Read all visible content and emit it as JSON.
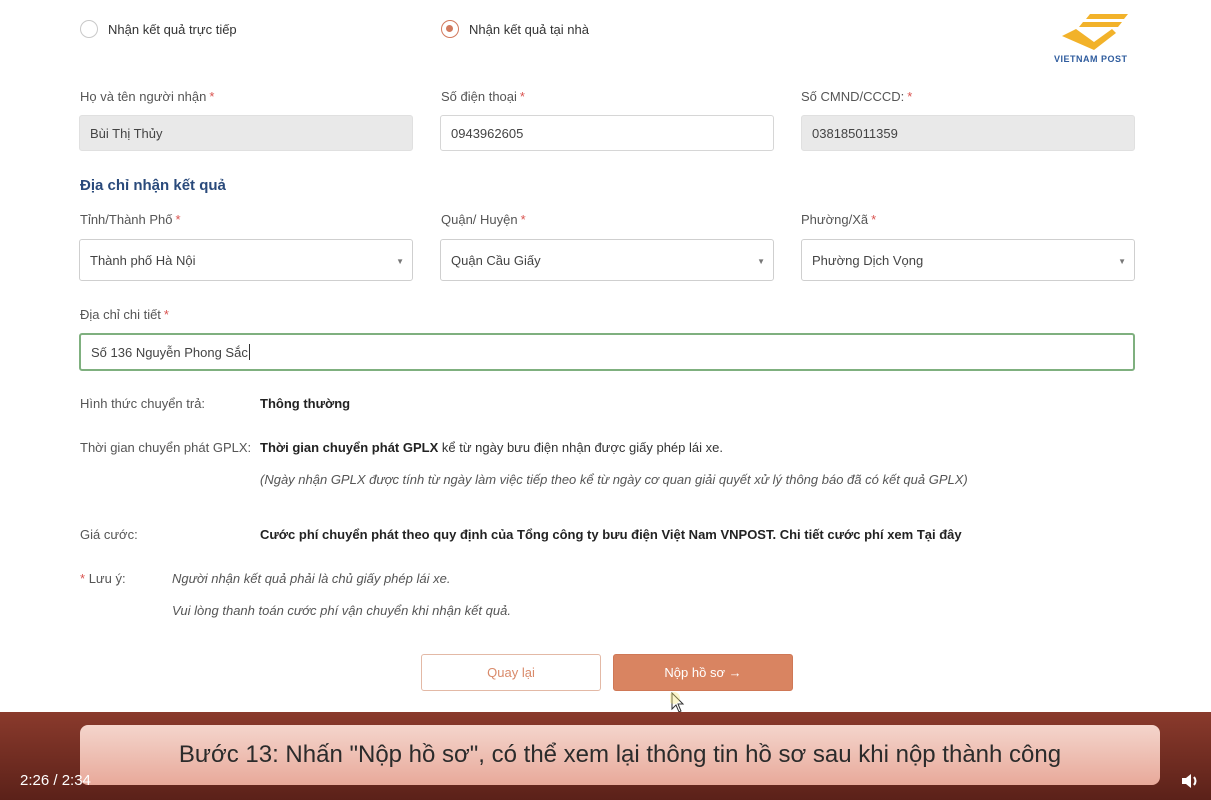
{
  "delivery_options": {
    "direct_label": "Nhận kết quả trực tiếp",
    "home_label": "Nhận kết quả tại nhà",
    "selected": "home"
  },
  "logo": {
    "text": "VIETNAM POST",
    "colors": {
      "yellow": "#f2b22a",
      "blue": "#2f5c9e"
    }
  },
  "recipient": {
    "name_label": "Họ và tên người nhận",
    "name_value": "Bùi Thị Thủy",
    "phone_label": "Số điện thoại",
    "phone_value": "0943962605",
    "id_label": "Số CMND/CCCD:",
    "id_value": "038185011359",
    "required_mark": "*"
  },
  "address": {
    "section_title": "Địa chỉ nhận kết quả",
    "province_label": "Tỉnh/Thành Phố",
    "province_value": "Thành phố Hà Nội",
    "district_label": "Quận/ Huyện",
    "district_value": "Quận Cầu Giấy",
    "ward_label": "Phường/Xã",
    "ward_value": "Phường Dịch Vọng",
    "detail_label": "Địa chỉ chi tiết",
    "detail_value": "Số 136 Nguyễn Phong Sắc"
  },
  "info": {
    "method_label": "Hình thức chuyển trả:",
    "method_value": "Thông thường",
    "time_label": "Thời gian chuyển phát GPLX:",
    "time_value_bold": "Thời gian chuyển phát GPLX",
    "time_value_rest": " kể từ ngày bưu điện nhận được giấy phép lái xe.",
    "time_note": "(Ngày nhận GPLX được tính từ ngày làm việc tiếp theo kể từ ngày cơ quan giải quyết xử lý thông báo đã có kết quả GPLX)",
    "price_label": "Giá cước:",
    "price_value": "Cước phí chuyển phát theo quy định của Tổng công ty bưu điện Việt Nam VNPOST. Chi tiết cước phí xem Tại đây",
    "note_label": "Lưu ý:",
    "note_line1": "Người nhận kết quả phải là chủ giấy phép lái xe.",
    "note_line2": "Vui lòng thanh toán cước phí vận chuyển khi nhận kết quả."
  },
  "buttons": {
    "back_label": "Quay lại",
    "submit_label": "Nộp hồ sơ →"
  },
  "video": {
    "caption": "Bước 13: Nhấn \"Nộp hồ sơ\", có thể xem lại thông tin hồ sơ sau khi nộp thành công",
    "time": "2:26 / 2:34"
  },
  "colors": {
    "accent": "#d98461",
    "heading": "#2a4a7b",
    "required": "#d9534f"
  }
}
